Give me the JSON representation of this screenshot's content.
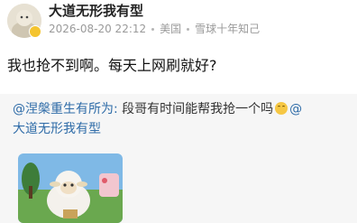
{
  "post": {
    "username": "大道无形我有型",
    "timestamp": "2026-08-20 22:12",
    "location": "美国",
    "source": "雪球十年知己",
    "text": "我也抢不到啊。每天上网刷就好?"
  },
  "quoted": {
    "author_mention": "@涅槃重生有所为:",
    "text": " 段哥有时间能帮我抢一个吗",
    "trailing_mention": "@",
    "second_line_mention": "大道无形我有型",
    "image_icon": "cartoon-sheep-image"
  }
}
